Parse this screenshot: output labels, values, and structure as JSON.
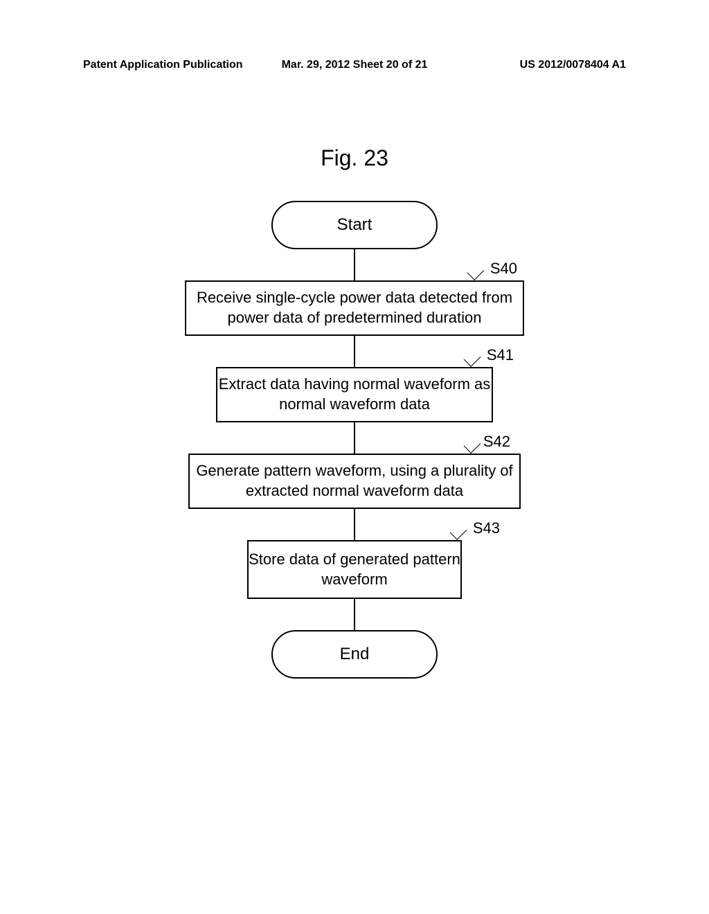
{
  "header": {
    "left": "Patent Application Publication",
    "center": "Mar. 29, 2012  Sheet 20 of 21",
    "right": "US 2012/0078404 A1"
  },
  "figure": {
    "title": "Fig. 23"
  },
  "flowchart": {
    "start": "Start",
    "end": "End",
    "steps": [
      {
        "label": "S40",
        "text": "Receive single-cycle power data detected from power data of predetermined duration"
      },
      {
        "label": "S41",
        "text": "Extract data having normal waveform as normal waveform data"
      },
      {
        "label": "S42",
        "text": "Generate pattern waveform, using a plurality of extracted normal waveform data"
      },
      {
        "label": "S43",
        "text": "Store data of generated pattern waveform"
      }
    ]
  },
  "chart_data": {
    "type": "flowchart",
    "title": "Fig. 23",
    "nodes": [
      {
        "id": "start",
        "type": "terminal",
        "text": "Start"
      },
      {
        "id": "S40",
        "type": "process",
        "text": "Receive single-cycle power data detected from power data of predetermined duration"
      },
      {
        "id": "S41",
        "type": "process",
        "text": "Extract data having normal waveform as normal waveform data"
      },
      {
        "id": "S42",
        "type": "process",
        "text": "Generate pattern waveform, using a plurality of extracted normal waveform data"
      },
      {
        "id": "S43",
        "type": "process",
        "text": "Store data of generated pattern waveform"
      },
      {
        "id": "end",
        "type": "terminal",
        "text": "End"
      }
    ],
    "edges": [
      {
        "from": "start",
        "to": "S40"
      },
      {
        "from": "S40",
        "to": "S41"
      },
      {
        "from": "S41",
        "to": "S42"
      },
      {
        "from": "S42",
        "to": "S43"
      },
      {
        "from": "S43",
        "to": "end"
      }
    ]
  }
}
